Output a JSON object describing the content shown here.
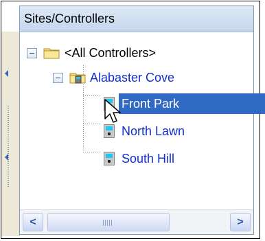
{
  "panel": {
    "title": "Sites/Controllers"
  },
  "tree": {
    "root": {
      "label": "<All Controllers>",
      "icon": "folder-icon",
      "expanded": true
    },
    "site": {
      "label": "Alabaster Cove",
      "icon": "site-folder-icon",
      "expanded": true
    },
    "controllers": [
      {
        "label": "Front Park",
        "icon": "controller-icon",
        "selected": true
      },
      {
        "label": "North Lawn",
        "icon": "controller-icon",
        "selected": false
      },
      {
        "label": "South Hill",
        "icon": "controller-icon",
        "selected": false
      }
    ]
  },
  "scrollbar": {
    "left_arrow": "<",
    "right_arrow": ">"
  },
  "colors": {
    "selection": "#316ac5",
    "link_text": "#1030d0",
    "header": "#c4d6ee"
  }
}
